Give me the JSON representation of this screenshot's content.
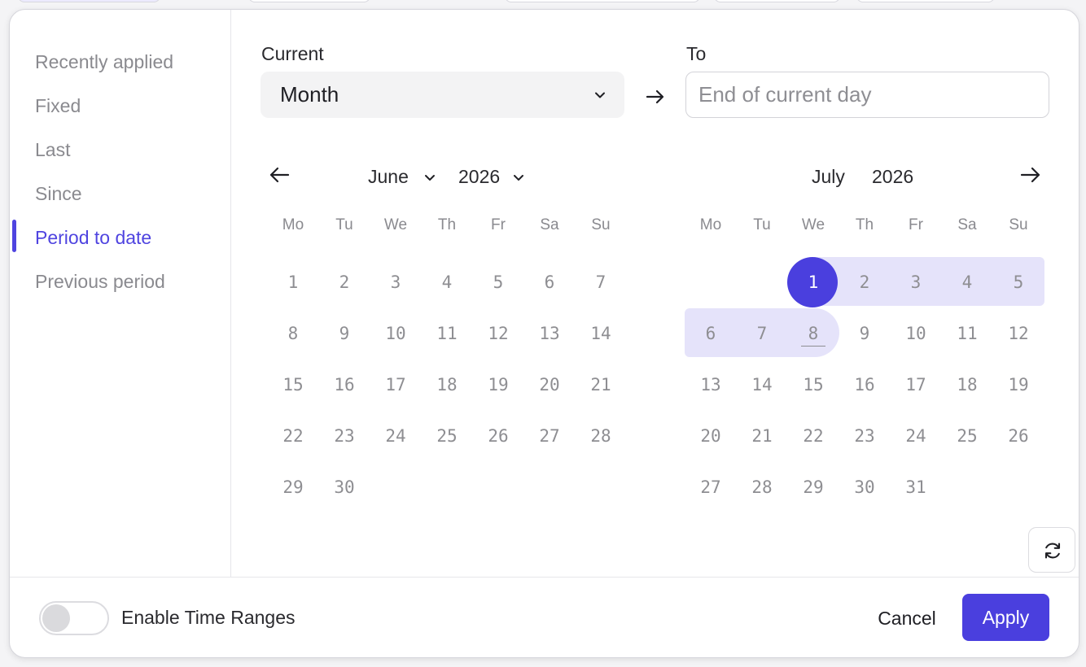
{
  "sidebar": {
    "items": [
      {
        "label": "Recently applied"
      },
      {
        "label": "Fixed"
      },
      {
        "label": "Last"
      },
      {
        "label": "Since"
      },
      {
        "label": "Period to date",
        "active": true
      },
      {
        "label": "Previous period"
      }
    ]
  },
  "range": {
    "from_label": "Current",
    "from_value": "Month",
    "to_label": "To",
    "to_placeholder": "End of current day",
    "to_value": ""
  },
  "calendar_left": {
    "month": "June",
    "year": "2026",
    "weekdays": [
      "Mo",
      "Tu",
      "We",
      "Th",
      "Fr",
      "Sa",
      "Su"
    ],
    "weeks": [
      [
        "1",
        "2",
        "3",
        "4",
        "5",
        "6",
        "7"
      ],
      [
        "8",
        "9",
        "10",
        "11",
        "12",
        "13",
        "14"
      ],
      [
        "15",
        "16",
        "17",
        "18",
        "19",
        "20",
        "21"
      ],
      [
        "22",
        "23",
        "24",
        "25",
        "26",
        "27",
        "28"
      ],
      [
        "29",
        "30",
        "",
        "",
        "",
        "",
        ""
      ]
    ]
  },
  "calendar_right": {
    "month": "July",
    "year": "2026",
    "weekdays": [
      "Mo",
      "Tu",
      "We",
      "Th",
      "Fr",
      "Sa",
      "Su"
    ],
    "weeks": [
      [
        "",
        "",
        "1",
        "2",
        "3",
        "4",
        "5"
      ],
      [
        "6",
        "7",
        "8",
        "9",
        "10",
        "11",
        "12"
      ],
      [
        "13",
        "14",
        "15",
        "16",
        "17",
        "18",
        "19"
      ],
      [
        "20",
        "21",
        "22",
        "23",
        "24",
        "25",
        "26"
      ],
      [
        "27",
        "28",
        "29",
        "30",
        "31",
        "",
        ""
      ]
    ],
    "selected_start": "1",
    "selected_end": "8",
    "today": "8"
  },
  "footer": {
    "toggle_label": "Enable Time Ranges",
    "toggle_on": false,
    "cancel_label": "Cancel",
    "apply_label": "Apply"
  },
  "colors": {
    "accent": "#4a3fde",
    "range_fill": "#e5e3fa",
    "muted_text": "#8a8a8f"
  },
  "icons": {
    "prev_month": "arrow-left-icon",
    "next_month": "arrow-right-icon",
    "range_arrow": "arrow-right-icon",
    "select_chevron": "chevron-down-icon",
    "refresh": "refresh-icon"
  }
}
